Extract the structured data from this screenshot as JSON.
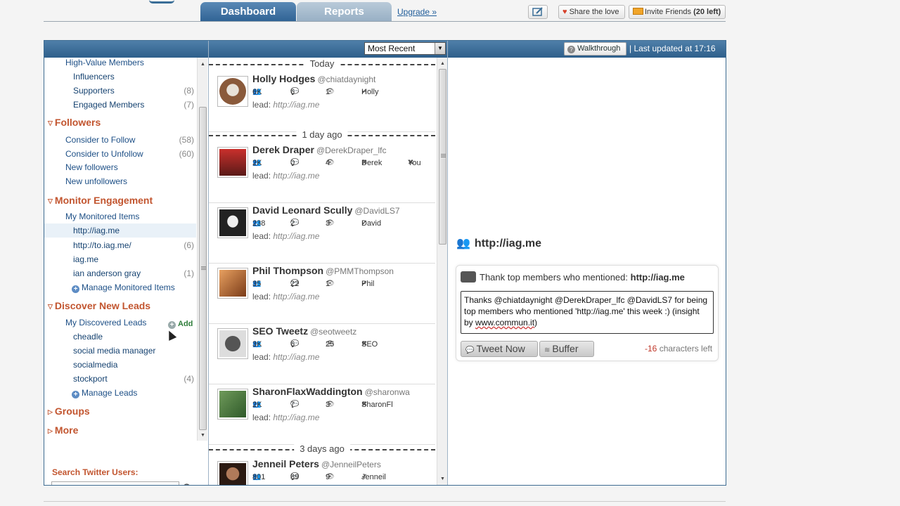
{
  "topnav": {
    "tabs": [
      {
        "label": "Dashboard"
      },
      {
        "label": "Reports"
      }
    ],
    "upgrade": "Upgrade »",
    "share": "Share the love",
    "invite_label": "Invite Friends",
    "invite_count": "(20 left)"
  },
  "toolbar": {
    "sort": "Most Recent",
    "walkthrough": "Walkthrough",
    "last_updated": "| Last updated at 17:16"
  },
  "sidebar": {
    "sections": [
      {
        "title": "Followers"
      },
      {
        "title": "Monitor Engagement"
      },
      {
        "title": "Discover New Leads"
      },
      {
        "title": "Groups"
      },
      {
        "title": "More"
      }
    ],
    "members": [
      {
        "label": "High-Value Members",
        "count": ""
      },
      {
        "label": "Influencers",
        "count": ""
      },
      {
        "label": "Supporters",
        "count": "(8)"
      },
      {
        "label": "Engaged Members",
        "count": "(7)"
      }
    ],
    "followers": [
      {
        "label": "Consider to Follow",
        "count": "(58)"
      },
      {
        "label": "Consider to Unfollow",
        "count": "(60)"
      },
      {
        "label": "New followers",
        "count": ""
      },
      {
        "label": "New unfollowers",
        "count": ""
      }
    ],
    "monitored_header": "My Monitored Items",
    "monitored": [
      {
        "label": "http://iag.me",
        "count": ""
      },
      {
        "label": "http://to.iag.me/",
        "count": "(6)"
      },
      {
        "label": "iag.me",
        "count": ""
      },
      {
        "label": "ian anderson gray",
        "count": "(1)"
      }
    ],
    "manage_monitored": "Manage Monitored Items",
    "add": "Add",
    "leads_header": "My Discovered Leads",
    "leads": [
      {
        "label": "cheadle",
        "count": ""
      },
      {
        "label": "social media manager",
        "count": ""
      },
      {
        "label": "socialmedia",
        "count": ""
      },
      {
        "label": "stockport",
        "count": "(4)"
      }
    ],
    "manage_leads": "Manage Leads",
    "search_label": "Search Twitter Users:",
    "search_placeholder": ""
  },
  "feed": {
    "dates": [
      "Today",
      "1 day ago",
      "3 days ago"
    ],
    "items": [
      {
        "name": "Holly Hodges",
        "handle": "@chiatdaynight",
        "followers": "6K",
        "replies": "6",
        "views": "1",
        "f1": "Holly",
        "f1_icon": "✔",
        "f2": "",
        "f2_icon": "",
        "lead_label": "lead:",
        "lead": "http://iag.me"
      },
      {
        "name": "Derek Draper",
        "handle": "@DerekDraper_lfc",
        "followers": "2K",
        "replies": "0",
        "views": "4",
        "f1": "Derek",
        "f1_icon": "✖",
        "f2": "You",
        "f2_icon": "✖",
        "lead_label": "lead:",
        "lead": "http://iag.me"
      },
      {
        "name": "David Leonard Scully",
        "handle": "@DavidLS7",
        "followers": "238",
        "replies": "2",
        "views": "3",
        "f1": "David",
        "f1_icon": "✔",
        "f2": "",
        "f2_icon": "",
        "lead_label": "lead:",
        "lead": "http://iag.me"
      },
      {
        "name": "Phil Thompson",
        "handle": "@PMMThompson",
        "followers": "35",
        "replies": "22",
        "views": "1",
        "f1": "Phil",
        "f1_icon": "✔",
        "f2": "",
        "f2_icon": "",
        "lead_label": "lead:",
        "lead": "http://iag.me"
      },
      {
        "name": "SEO Tweetz",
        "handle": "@seotweetz",
        "followers": "3K",
        "replies": "6",
        "views": "25",
        "f1": "SEO",
        "f1_icon": "✖",
        "f2": "",
        "f2_icon": "",
        "lead_label": "lead:",
        "lead": "http://iag.me"
      },
      {
        "name": "SharonFlaxWaddington",
        "handle": "@sharonwa",
        "followers": "2K",
        "replies": "7",
        "views": "3",
        "f1": "SharonFl",
        "f1_icon": "✖",
        "f2": "",
        "f2_icon": "",
        "lead_label": "lead:",
        "lead": "http://iag.me"
      },
      {
        "name": "Jenneil Peters",
        "handle": "@JenneilPeters",
        "followers": "801",
        "replies": "89",
        "views": "9",
        "f1": "Jenneil",
        "f1_icon": "✔",
        "f2": "",
        "f2_icon": "",
        "lead_label": "",
        "lead": ""
      }
    ]
  },
  "panel": {
    "title": "http://iag.me",
    "prompt": "Thank top members who mentioned:",
    "prompt_target": "http://iag.me",
    "message_main": "Thanks @chiatdaynight @DerekDraper_lfc @DavidLS7 for being top members who mentioned 'http://iag.me' this week :) (insight by ",
    "message_link": "www.commun.it",
    "message_end": ")",
    "tweet_button": "Tweet Now",
    "buffer_button": "Buffer",
    "chars_count": "-16",
    "chars_label": "characters left"
  },
  "colors": {
    "header_blue": "#2e5f8b",
    "section_orange": "#c2552f",
    "link_blue": "#1d4f86"
  }
}
